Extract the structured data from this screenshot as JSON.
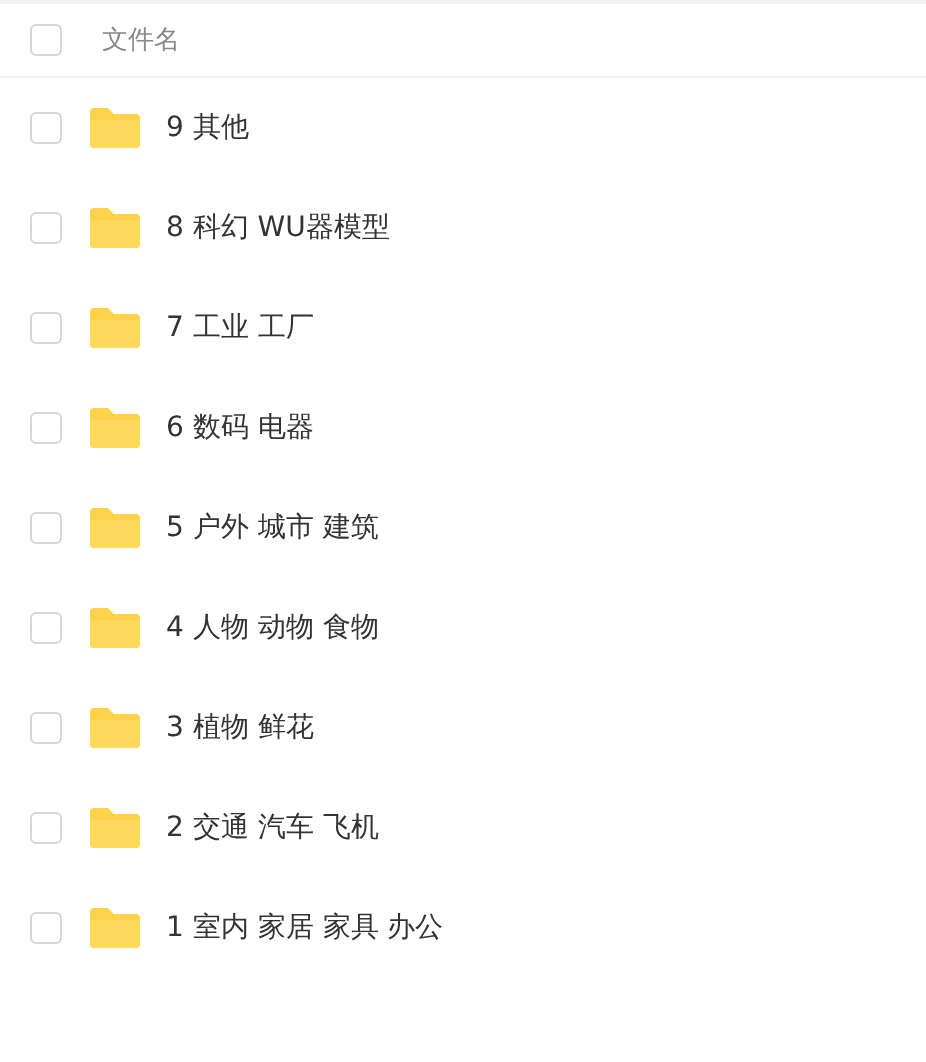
{
  "header": {
    "checked": false,
    "column_label": "文件名"
  },
  "files": [
    {
      "name": "9 其他",
      "checked": false
    },
    {
      "name": "8 科幻 WU器模型",
      "checked": false
    },
    {
      "name": "7 工业 工厂",
      "checked": false
    },
    {
      "name": "6 数码 电器",
      "checked": false
    },
    {
      "name": "5 户外 城市 建筑",
      "checked": false
    },
    {
      "name": "4 人物 动物 食物",
      "checked": false
    },
    {
      "name": "3 植物 鲜花",
      "checked": false
    },
    {
      "name": "2 交通 汽车 飞机",
      "checked": false
    },
    {
      "name": "1 室内 家居 家具 办公",
      "checked": false
    }
  ]
}
